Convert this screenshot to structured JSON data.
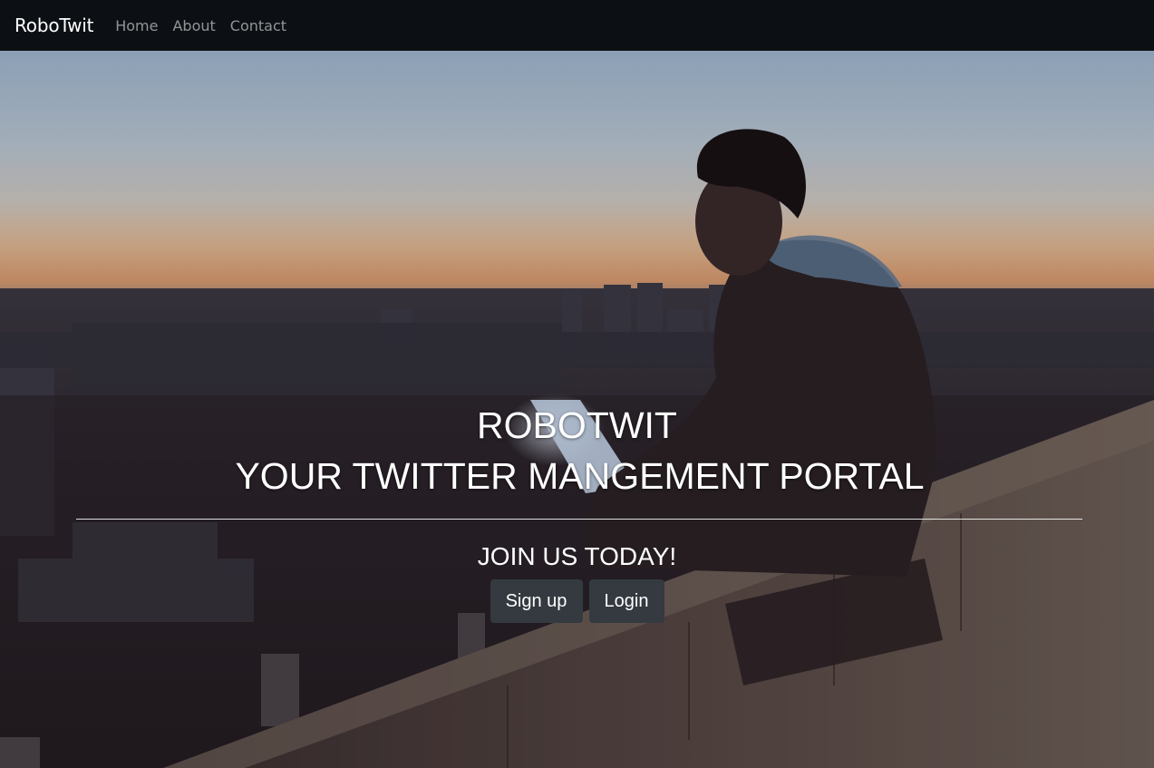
{
  "navbar": {
    "brand": "RoboTwit",
    "links": [
      "Home",
      "About",
      "Contact"
    ]
  },
  "hero": {
    "title_line1": "ROBOTWIT",
    "title_line2": "YOUR TWITTER MANGEMENT PORTAL",
    "subtitle": "JOIN US TODAY!",
    "signup_label": "Sign up",
    "login_label": "Login",
    "background_image": "person-with-laptop-on-wall-overlooking-city-at-dusk"
  },
  "colors": {
    "navbar_bg": "#0c1014",
    "button_bg": "#343a40",
    "text": "#ffffff"
  }
}
